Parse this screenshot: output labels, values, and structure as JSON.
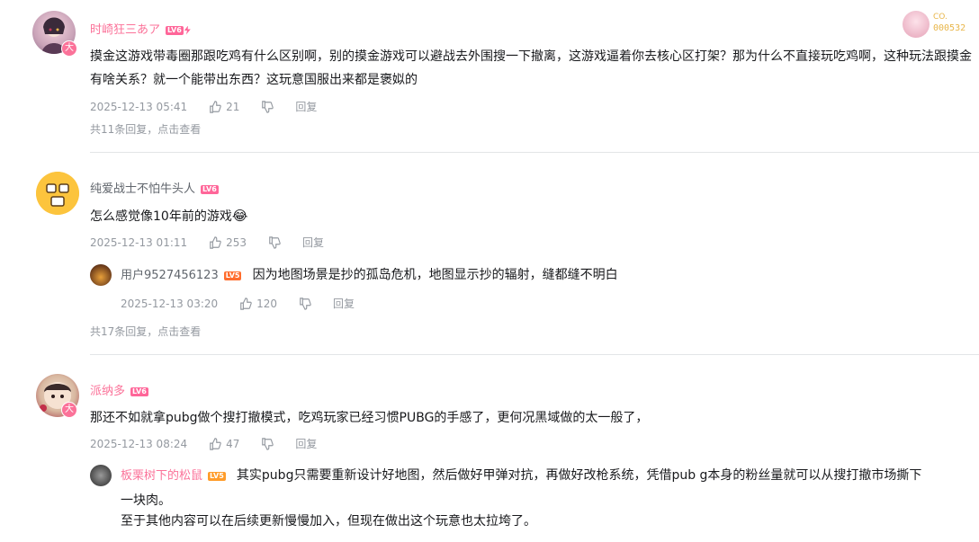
{
  "comments": [
    {
      "username": "时崎狂三あア",
      "level": "LV6",
      "content": "摸金这游戏带毒圈那跟吃鸡有什么区别啊，别的摸金游戏可以避战去外围搜一下撤离，这游戏逼着你去核心区打架？那为什么不直接玩吃鸡啊，这种玩法跟摸金有啥关系？就一个能带出东西？这玩意国服出来都是褒姒的",
      "time": "2025-12-13 05:41",
      "likes": "21",
      "reply_label": "回复",
      "more_replies": "共11条回复，点击查看",
      "badge_text": "CO.",
      "badge_number": "000532",
      "avatar_badge": "大"
    },
    {
      "username": "纯爱战士不怕牛头人",
      "level": "LV6",
      "content": "怎么感觉像10年前的游戏",
      "emoji": "😂",
      "time": "2025-12-13 01:11",
      "likes": "253",
      "reply_label": "回复",
      "sub_reply": {
        "username": "用户9527456123",
        "level": "LV5",
        "content": "因为地图场景是抄的孤岛危机，地图显示抄的辐射，缝都缝不明白",
        "time": "2025-12-13 03:20",
        "likes": "120",
        "reply_label": "回复"
      },
      "more_replies": "共17条回复，点击查看"
    },
    {
      "username": "派纳多",
      "level": "LV6",
      "content": "那还不如就拿pubg做个搜打撤模式，吃鸡玩家已经习惯PUBG的手感了，更何况黑域做的太一般了，",
      "time": "2025-12-13 08:24",
      "likes": "47",
      "reply_label": "回复",
      "avatar_badge": "大",
      "sub_reply": {
        "username": "板栗树下的松鼠",
        "level": "LV5",
        "content_line1": "其实pubg只需要重新设计好地图，然后做好甲弹对抗，再做好改枪系统，凭借pub g本身的粉丝量就可以从搜打撤市场撕下",
        "content_line2": "一块肉。",
        "content_line3": "至于其他内容可以在后续更新慢慢加入，但现在做出这个玩意也太拉垮了。"
      }
    }
  ],
  "colors": {
    "vip_pink": "#fb7299",
    "level_orange": "#ff9c2a",
    "meta_gray": "#9499a0"
  }
}
